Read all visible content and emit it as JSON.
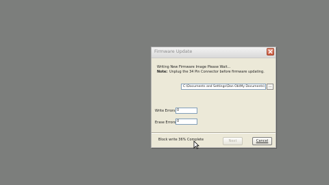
{
  "dialog": {
    "title": "Firmware Update",
    "writing_message": "Writing New Firmware Image Please Wait...",
    "note_label": "Note:",
    "note_text": "Unplug the 34 Pin Connector before firmware updating.",
    "path_value": "C:\\Documents and Settings\\Dan Ob\\My Documents\\",
    "browse_label": "...",
    "write_errors_label": "Write Errors",
    "write_errors_value": "0",
    "erase_errors_label": "Erase Errors",
    "erase_errors_value": "0",
    "status_text": "Block write 36% Complete",
    "next_label": "Next",
    "cancel_label": "Cancel"
  },
  "colors": {
    "desktop": "#7c7e7c",
    "dialog_bg": "#ece9d8",
    "close_button": "#c9563d"
  },
  "icons": {
    "close": "close-icon",
    "cursor": "mouse-pointer-icon"
  }
}
